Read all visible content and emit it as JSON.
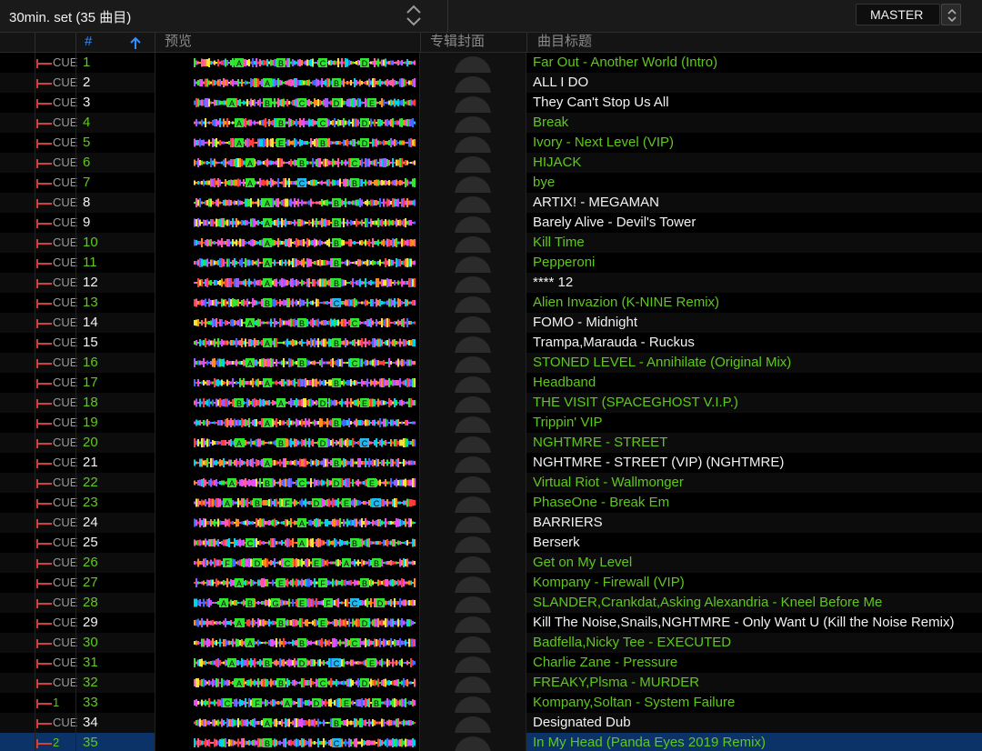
{
  "playlist": {
    "title": "30min. set (35 曲目)",
    "sort_icon": "up-down-arrows-icon"
  },
  "deck": {
    "label": "MASTER",
    "spinner_icon": "up-down-arrows-icon"
  },
  "columns": {
    "number": "#",
    "preview": "预览",
    "artwork": "专辑封面",
    "title": "曲目标题",
    "sort_indicator_icon": "arrow-up-icon"
  },
  "colors": {
    "played": "#5fc81c",
    "unplayed": "#f2f2f2",
    "selected_row": "#0c3368",
    "cue_marker": "#d04040",
    "accent": "#2f8fff"
  },
  "tracks": [
    {
      "cue": "CUE",
      "num": "1",
      "title": "Far Out - Another World (Intro)",
      "played": true,
      "markers": "ABCD"
    },
    {
      "cue": "CUE",
      "num": "2",
      "title": "ALL I DO",
      "played": false,
      "markers": "AB"
    },
    {
      "cue": "CUE",
      "num": "3",
      "title": "They Can't Stop Us All",
      "played": false,
      "markers": "ABCDE"
    },
    {
      "cue": "CUE",
      "num": "4",
      "title": "Break",
      "played": true,
      "markers": "ABCD"
    },
    {
      "cue": "CUE",
      "num": "5",
      "title": "Ivory - Next Level (VIP)",
      "played": true,
      "markers": "AEBD"
    },
    {
      "cue": "CUE",
      "num": "6",
      "title": "HIJACK",
      "played": true,
      "markers": "ABC"
    },
    {
      "cue": "CUE",
      "num": "7",
      "title": "bye",
      "played": true,
      "markers": "ACB"
    },
    {
      "cue": "CUE",
      "num": "8",
      "title": "ARTIX! - MEGAMAN",
      "played": false,
      "markers": "AB"
    },
    {
      "cue": "CUE",
      "num": "9",
      "title": "Barely Alive - Devil's Tower",
      "played": false,
      "markers": "AB"
    },
    {
      "cue": "CUE",
      "num": "10",
      "title": "Kill Time",
      "played": true,
      "markers": "AB"
    },
    {
      "cue": "CUE",
      "num": "11",
      "title": "Pepperoni",
      "played": true,
      "markers": "AB"
    },
    {
      "cue": "CUE",
      "num": "12",
      "title": "**** 12",
      "played": false,
      "markers": "AB"
    },
    {
      "cue": "CUE",
      "num": "13",
      "title": "Alien Invazion (K-NINE Remix)",
      "played": true,
      "markers": "BC"
    },
    {
      "cue": "CUE",
      "num": "14",
      "title": "FOMO - Midnight",
      "played": false,
      "markers": "ABC"
    },
    {
      "cue": "CUE",
      "num": "15",
      "title": "Trampa,Marauda - Ruckus",
      "played": false,
      "markers": "AB"
    },
    {
      "cue": "CUE",
      "num": "16",
      "title": "STONED LEVEL - Annihilate (Original Mix)",
      "played": true,
      "markers": "ABC"
    },
    {
      "cue": "CUE",
      "num": "17",
      "title": "Headband",
      "played": true,
      "markers": "AB"
    },
    {
      "cue": "CUE",
      "num": "18",
      "title": "THE VISIT (SPACEGHOST V.I.P.)",
      "played": true,
      "markers": "BADE"
    },
    {
      "cue": "CUE",
      "num": "19",
      "title": "Trippin' VIP",
      "played": true,
      "markers": "AB"
    },
    {
      "cue": "CUE",
      "num": "20",
      "title": "NGHTMRE - STREET",
      "played": true,
      "markers": "ABDC"
    },
    {
      "cue": "CUE",
      "num": "21",
      "title": "NGHTMRE - STREET (VIP) (NGHTMRE)",
      "played": false,
      "markers": "AB"
    },
    {
      "cue": "CUE",
      "num": "22",
      "title": "Virtual Riot - Wallmonger",
      "played": true,
      "markers": "ABCDE"
    },
    {
      "cue": "CUE",
      "num": "23",
      "title": "PhaseOne - Break Em",
      "played": true,
      "markers": "ABFDEC"
    },
    {
      "cue": "CUE",
      "num": "24",
      "title": "BARRIERS",
      "played": false,
      "markers": "A"
    },
    {
      "cue": "CUE",
      "num": "25",
      "title": "Berserk",
      "played": false,
      "markers": "CAB"
    },
    {
      "cue": "CUE",
      "num": "26",
      "title": "Get on My Level",
      "played": true,
      "markers": "FDCEAB"
    },
    {
      "cue": "CUE",
      "num": "27",
      "title": "Kompany - Firewall (VIP)",
      "played": true,
      "markers": "AEFB"
    },
    {
      "cue": "CUE",
      "num": "28",
      "title": "SLANDER,Crankdat,Asking Alexandria - Kneel Before Me",
      "played": true,
      "markers": "ABGEFCD"
    },
    {
      "cue": "CUE",
      "num": "29",
      "title": "Kill The Noise,Snails,NGHTMRE - Only Want U (Kill the Noise Remix)",
      "played": false,
      "markers": "ABED"
    },
    {
      "cue": "CUE",
      "num": "30",
      "title": "Badfella,Nicky Tee - EXECUTED",
      "played": true,
      "markers": "ABC"
    },
    {
      "cue": "CUE",
      "num": "31",
      "title": "Charlie Zane - Pressure",
      "played": true,
      "markers": "ABDCE"
    },
    {
      "cue": "CUE",
      "num": "32",
      "title": "FREAKY,Plsma - MURDER",
      "played": true,
      "markers": "ABCD"
    },
    {
      "cue": "1",
      "num": "33",
      "title": "Kompany,Soltan - System Failure",
      "played": true,
      "markers": "CFADEB"
    },
    {
      "cue": "CUE",
      "num": "34",
      "title": "Designated Dub",
      "played": false,
      "markers": "AB"
    },
    {
      "cue": "2",
      "num": "35",
      "title": "In My Head (Panda Eyes 2019 Remix)",
      "played": true,
      "selected": true,
      "markers": "BC"
    }
  ]
}
